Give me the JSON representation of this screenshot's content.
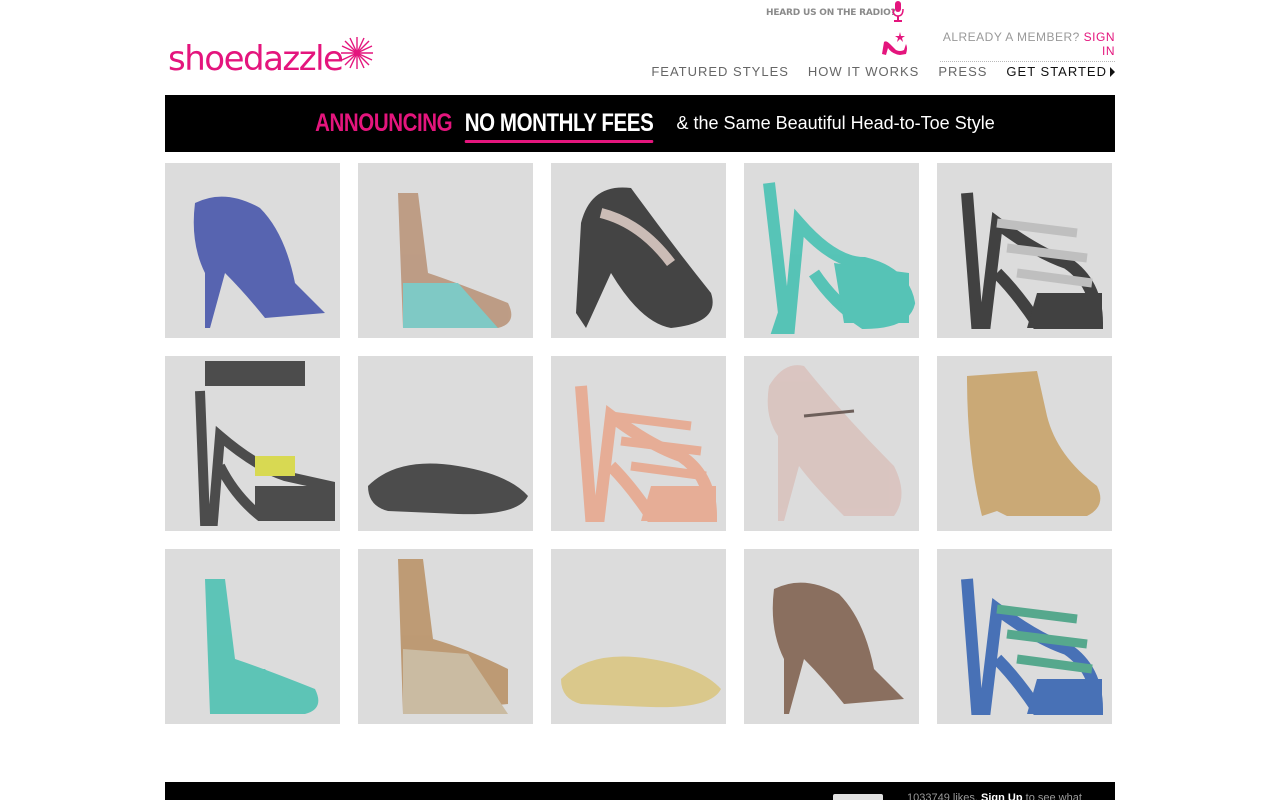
{
  "header": {
    "radio_text": "HEARD US ON THE RADIO?",
    "logo_text": "shoedazzle",
    "member_prefix": "ALREADY A MEMBER?",
    "sign_in": "SIGN IN",
    "nav": [
      "FEATURED STYLES",
      "HOW IT WORKS",
      "PRESS",
      "GET STARTED"
    ]
  },
  "banner": {
    "part1": "ANNOUNCING",
    "part2": "NO MONTHLY FEES",
    "part3": "& the Same Beautiful Head-to-Toe Style"
  },
  "shoes": [
    {
      "style": "bootie",
      "color": "#3f4fa8"
    },
    {
      "style": "wedge",
      "color": "#b89276",
      "accent": "#6fc6c2"
    },
    {
      "style": "pump",
      "color": "#2a2a2a",
      "accent": "#c9b7b0"
    },
    {
      "style": "slingback",
      "color": "#3fbfb0"
    },
    {
      "style": "strappy",
      "color": "#262626",
      "accent": "#bbbbbb"
    },
    {
      "style": "cuff",
      "color": "#333333",
      "accent": "#d8d93a"
    },
    {
      "style": "flat",
      "color": "#333333"
    },
    {
      "style": "strappy",
      "color": "#e8a58a"
    },
    {
      "style": "maryjane",
      "color": "#d9c1bc"
    },
    {
      "style": "boot",
      "color": "#c7a064"
    },
    {
      "style": "wedge",
      "color": "#47c0b0",
      "accent": "#47c0b0"
    },
    {
      "style": "cork",
      "color": "#b88f63",
      "accent": "#c8b698"
    },
    {
      "style": "flat",
      "color": "#d9c47d"
    },
    {
      "style": "bootie",
      "color": "#7b5c49"
    },
    {
      "style": "strappy",
      "color": "#2f5fb0",
      "accent": "#3f9f80"
    }
  ],
  "footer": {
    "likes": "1033749 likes.",
    "signup": "Sign Up",
    "rest": "to see what"
  },
  "colors": {
    "brand_pink": "#e4157d",
    "tile_bg": "#dcdcdc",
    "banner_bg": "#000000"
  }
}
